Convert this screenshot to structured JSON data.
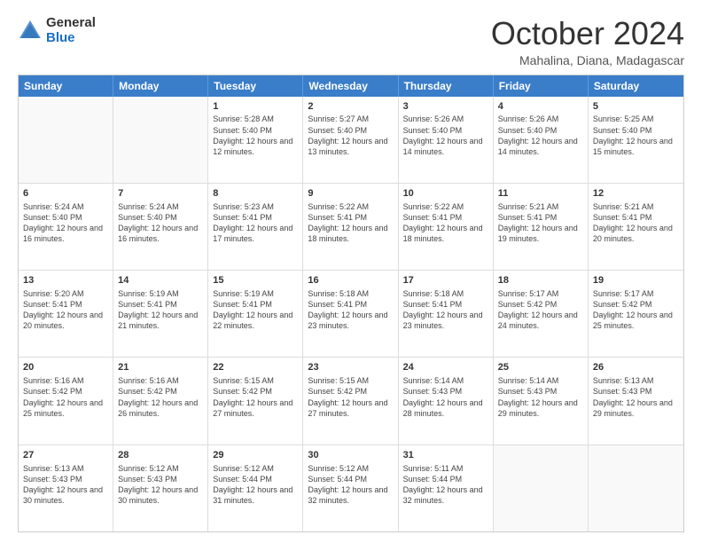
{
  "logo": {
    "general": "General",
    "blue": "Blue"
  },
  "header": {
    "month": "October 2024",
    "location": "Mahalina, Diana, Madagascar"
  },
  "weekdays": [
    "Sunday",
    "Monday",
    "Tuesday",
    "Wednesday",
    "Thursday",
    "Friday",
    "Saturday"
  ],
  "rows": [
    [
      {
        "day": "",
        "sunrise": "",
        "sunset": "",
        "daylight": "",
        "empty": true
      },
      {
        "day": "",
        "sunrise": "",
        "sunset": "",
        "daylight": "",
        "empty": true
      },
      {
        "day": "1",
        "sunrise": "Sunrise: 5:28 AM",
        "sunset": "Sunset: 5:40 PM",
        "daylight": "Daylight: 12 hours and 12 minutes."
      },
      {
        "day": "2",
        "sunrise": "Sunrise: 5:27 AM",
        "sunset": "Sunset: 5:40 PM",
        "daylight": "Daylight: 12 hours and 13 minutes."
      },
      {
        "day": "3",
        "sunrise": "Sunrise: 5:26 AM",
        "sunset": "Sunset: 5:40 PM",
        "daylight": "Daylight: 12 hours and 14 minutes."
      },
      {
        "day": "4",
        "sunrise": "Sunrise: 5:26 AM",
        "sunset": "Sunset: 5:40 PM",
        "daylight": "Daylight: 12 hours and 14 minutes."
      },
      {
        "day": "5",
        "sunrise": "Sunrise: 5:25 AM",
        "sunset": "Sunset: 5:40 PM",
        "daylight": "Daylight: 12 hours and 15 minutes."
      }
    ],
    [
      {
        "day": "6",
        "sunrise": "Sunrise: 5:24 AM",
        "sunset": "Sunset: 5:40 PM",
        "daylight": "Daylight: 12 hours and 16 minutes."
      },
      {
        "day": "7",
        "sunrise": "Sunrise: 5:24 AM",
        "sunset": "Sunset: 5:40 PM",
        "daylight": "Daylight: 12 hours and 16 minutes."
      },
      {
        "day": "8",
        "sunrise": "Sunrise: 5:23 AM",
        "sunset": "Sunset: 5:41 PM",
        "daylight": "Daylight: 12 hours and 17 minutes."
      },
      {
        "day": "9",
        "sunrise": "Sunrise: 5:22 AM",
        "sunset": "Sunset: 5:41 PM",
        "daylight": "Daylight: 12 hours and 18 minutes."
      },
      {
        "day": "10",
        "sunrise": "Sunrise: 5:22 AM",
        "sunset": "Sunset: 5:41 PM",
        "daylight": "Daylight: 12 hours and 18 minutes."
      },
      {
        "day": "11",
        "sunrise": "Sunrise: 5:21 AM",
        "sunset": "Sunset: 5:41 PM",
        "daylight": "Daylight: 12 hours and 19 minutes."
      },
      {
        "day": "12",
        "sunrise": "Sunrise: 5:21 AM",
        "sunset": "Sunset: 5:41 PM",
        "daylight": "Daylight: 12 hours and 20 minutes."
      }
    ],
    [
      {
        "day": "13",
        "sunrise": "Sunrise: 5:20 AM",
        "sunset": "Sunset: 5:41 PM",
        "daylight": "Daylight: 12 hours and 20 minutes."
      },
      {
        "day": "14",
        "sunrise": "Sunrise: 5:19 AM",
        "sunset": "Sunset: 5:41 PM",
        "daylight": "Daylight: 12 hours and 21 minutes."
      },
      {
        "day": "15",
        "sunrise": "Sunrise: 5:19 AM",
        "sunset": "Sunset: 5:41 PM",
        "daylight": "Daylight: 12 hours and 22 minutes."
      },
      {
        "day": "16",
        "sunrise": "Sunrise: 5:18 AM",
        "sunset": "Sunset: 5:41 PM",
        "daylight": "Daylight: 12 hours and 23 minutes."
      },
      {
        "day": "17",
        "sunrise": "Sunrise: 5:18 AM",
        "sunset": "Sunset: 5:41 PM",
        "daylight": "Daylight: 12 hours and 23 minutes."
      },
      {
        "day": "18",
        "sunrise": "Sunrise: 5:17 AM",
        "sunset": "Sunset: 5:42 PM",
        "daylight": "Daylight: 12 hours and 24 minutes."
      },
      {
        "day": "19",
        "sunrise": "Sunrise: 5:17 AM",
        "sunset": "Sunset: 5:42 PM",
        "daylight": "Daylight: 12 hours and 25 minutes."
      }
    ],
    [
      {
        "day": "20",
        "sunrise": "Sunrise: 5:16 AM",
        "sunset": "Sunset: 5:42 PM",
        "daylight": "Daylight: 12 hours and 25 minutes."
      },
      {
        "day": "21",
        "sunrise": "Sunrise: 5:16 AM",
        "sunset": "Sunset: 5:42 PM",
        "daylight": "Daylight: 12 hours and 26 minutes."
      },
      {
        "day": "22",
        "sunrise": "Sunrise: 5:15 AM",
        "sunset": "Sunset: 5:42 PM",
        "daylight": "Daylight: 12 hours and 27 minutes."
      },
      {
        "day": "23",
        "sunrise": "Sunrise: 5:15 AM",
        "sunset": "Sunset: 5:42 PM",
        "daylight": "Daylight: 12 hours and 27 minutes."
      },
      {
        "day": "24",
        "sunrise": "Sunrise: 5:14 AM",
        "sunset": "Sunset: 5:43 PM",
        "daylight": "Daylight: 12 hours and 28 minutes."
      },
      {
        "day": "25",
        "sunrise": "Sunrise: 5:14 AM",
        "sunset": "Sunset: 5:43 PM",
        "daylight": "Daylight: 12 hours and 29 minutes."
      },
      {
        "day": "26",
        "sunrise": "Sunrise: 5:13 AM",
        "sunset": "Sunset: 5:43 PM",
        "daylight": "Daylight: 12 hours and 29 minutes."
      }
    ],
    [
      {
        "day": "27",
        "sunrise": "Sunrise: 5:13 AM",
        "sunset": "Sunset: 5:43 PM",
        "daylight": "Daylight: 12 hours and 30 minutes."
      },
      {
        "day": "28",
        "sunrise": "Sunrise: 5:12 AM",
        "sunset": "Sunset: 5:43 PM",
        "daylight": "Daylight: 12 hours and 30 minutes."
      },
      {
        "day": "29",
        "sunrise": "Sunrise: 5:12 AM",
        "sunset": "Sunset: 5:44 PM",
        "daylight": "Daylight: 12 hours and 31 minutes."
      },
      {
        "day": "30",
        "sunrise": "Sunrise: 5:12 AM",
        "sunset": "Sunset: 5:44 PM",
        "daylight": "Daylight: 12 hours and 32 minutes."
      },
      {
        "day": "31",
        "sunrise": "Sunrise: 5:11 AM",
        "sunset": "Sunset: 5:44 PM",
        "daylight": "Daylight: 12 hours and 32 minutes."
      },
      {
        "day": "",
        "sunrise": "",
        "sunset": "",
        "daylight": "",
        "empty": true
      },
      {
        "day": "",
        "sunrise": "",
        "sunset": "",
        "daylight": "",
        "empty": true
      }
    ]
  ]
}
